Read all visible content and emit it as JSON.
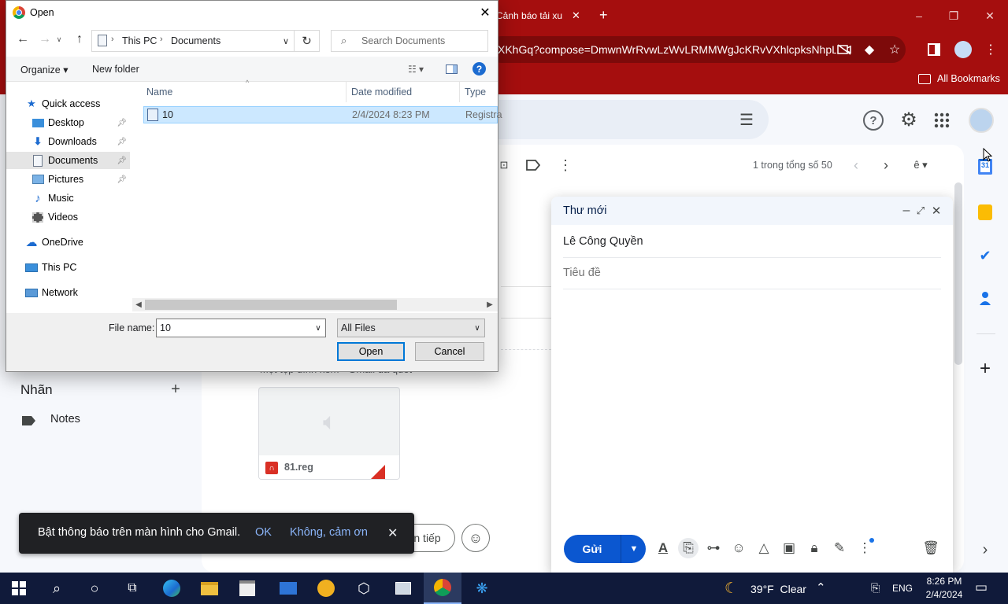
{
  "chrome": {
    "tab_title": "Cảnh báo tải xu",
    "tab_close": "✕",
    "new_tab": "+",
    "url": "XKhGq?compose=DmwnWrRvwLzWvLRMMWgJcKRvVXhlcpksNhpL...",
    "bookmarks_label": "All Bookmarks",
    "window_controls": [
      "–",
      "❐",
      "✕"
    ]
  },
  "gmail": {
    "pagination": "1 trong tổng số 50",
    "labels_heading": "Nhãn",
    "labels_add": "+",
    "labels": [
      "Notes"
    ],
    "attachment_name": "81.reg",
    "partial_heading": "Một tệp đính kèm • Gmail đã quét",
    "reply_partial": "n tiếp",
    "right_rail_add": "+",
    "right_rail_more": "›"
  },
  "compose": {
    "title": "Thư mới",
    "recipient": "Lê Công Quyền",
    "subject_placeholder": "Tiêu đề",
    "send_label": "Gửi",
    "icons": [
      "format-text-icon",
      "attach-icon",
      "link-icon",
      "emoji-icon",
      "drive-icon",
      "photo-icon",
      "lock-icon",
      "signature-icon",
      "more-options-icon",
      "trash-icon"
    ],
    "accent": "#0b57d0"
  },
  "snackbar": {
    "message": "Bật thông báo trên màn hình cho Gmail.",
    "ok": "OK",
    "dismiss": "Không, cảm ơn",
    "close": "✕"
  },
  "dialog": {
    "title": "Open",
    "breadcrumb": [
      "This PC",
      "Documents"
    ],
    "search_placeholder": "Search Documents",
    "organize": "Organize",
    "new_folder": "New folder",
    "help": "?",
    "tree": {
      "quick_access": "Quick access",
      "items": [
        {
          "label": "Desktop",
          "icon": "desktop-icon"
        },
        {
          "label": "Downloads",
          "icon": "downloads-icon"
        },
        {
          "label": "Documents",
          "icon": "documents-icon"
        },
        {
          "label": "Pictures",
          "icon": "pictures-icon"
        },
        {
          "label": "Music",
          "icon": "music-icon"
        },
        {
          "label": "Videos",
          "icon": "videos-icon"
        }
      ],
      "onedrive": "OneDrive",
      "this_pc": "This PC",
      "network": "Network"
    },
    "columns": [
      "Name",
      "Date modified",
      "Type"
    ],
    "files": [
      {
        "name": "10",
        "date": "2/4/2024 8:23 PM",
        "type": "Registra"
      }
    ],
    "file_name_label": "File name:",
    "file_name_value": "10",
    "file_type": "All Files",
    "open_button": "Open",
    "cancel_button": "Cancel"
  },
  "taskbar": {
    "weather": "39°F  Clear",
    "language": "ENG",
    "time": "8:26 PM",
    "date": "2/4/2024"
  }
}
